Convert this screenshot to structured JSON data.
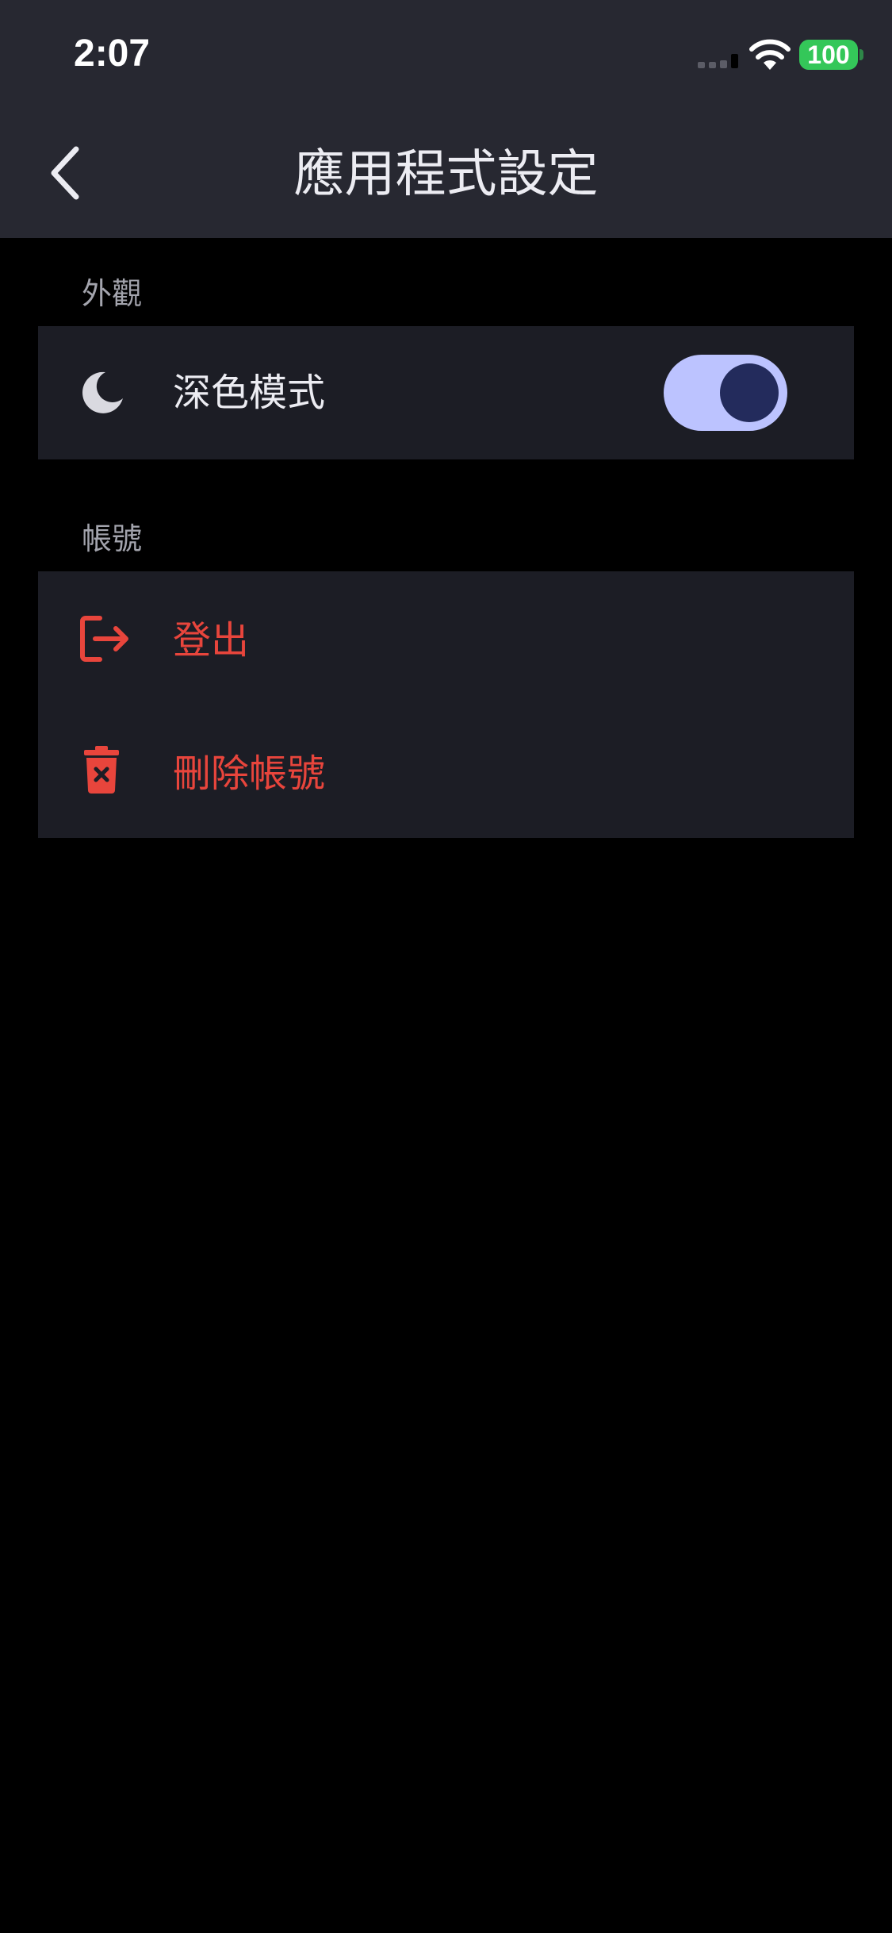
{
  "status_bar": {
    "time": "2:07",
    "battery_level": "100"
  },
  "nav": {
    "title": "應用程式設定",
    "back_icon": "chevron-left-icon"
  },
  "appearance": {
    "section_title": "外觀",
    "dark_mode": {
      "icon": "moon-icon",
      "label": "深色模式",
      "enabled": true
    }
  },
  "account": {
    "section_title": "帳號",
    "logout": {
      "icon": "logout-icon",
      "label": "登出"
    },
    "delete_account": {
      "icon": "trash-icon",
      "label": "刪除帳號"
    }
  },
  "colors": {
    "bar_background": "#272831",
    "page_background": "#000000",
    "group_background": "#1c1d25",
    "danger": "#e8453c",
    "toggle_track": "#bcc3ff",
    "toggle_knob": "#232b5c",
    "battery": "#34c759"
  }
}
